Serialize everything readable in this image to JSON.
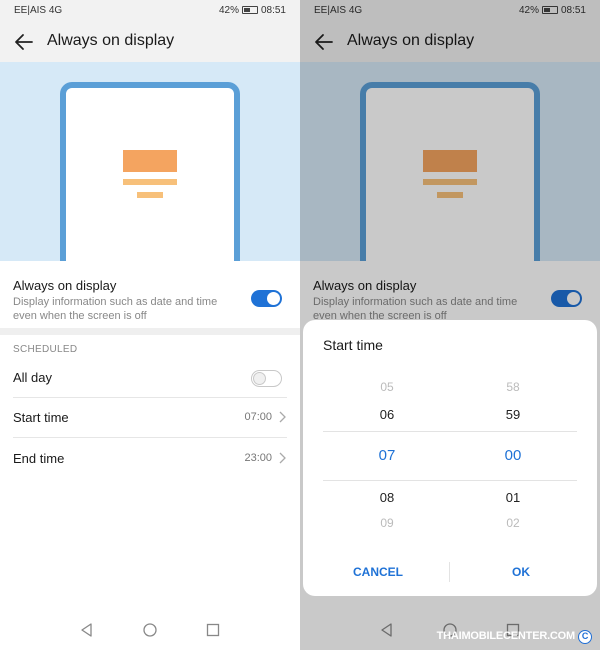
{
  "status_bar": {
    "carrier": "EE|AIS",
    "signal_text": "4G",
    "battery_percent": "42%",
    "time": "08:51"
  },
  "app_bar": {
    "title": "Always on display"
  },
  "aod_setting": {
    "title": "Always on display",
    "description": "Display information such as date and time even when the screen is off",
    "enabled": true
  },
  "scheduled": {
    "header": "SCHEDULED",
    "all_day": {
      "label": "All day",
      "enabled": false
    },
    "start_time": {
      "label": "Start time",
      "value": "07:00"
    },
    "end_time": {
      "label": "End time",
      "value": "23:00"
    }
  },
  "dialog": {
    "title": "Start time",
    "hours": [
      "05",
      "06",
      "07",
      "08",
      "09"
    ],
    "minutes": [
      "58",
      "59",
      "00",
      "01",
      "02"
    ],
    "selected_hour": "07",
    "selected_minute": "00",
    "cancel_label": "CANCEL",
    "ok_label": "OK"
  },
  "watermark": {
    "text": "THAIMOBILECENTER.COM",
    "copy_mark": "C"
  },
  "colors": {
    "accent": "#1f72d6",
    "hero_bg": "#d6e9f7",
    "phone_frame": "#5b9fd7",
    "aod_orange": "#f4a460"
  },
  "icons": [
    "back-arrow-icon",
    "chevron-right-icon",
    "nav-back-icon",
    "nav-home-icon",
    "nav-recents-icon"
  ]
}
